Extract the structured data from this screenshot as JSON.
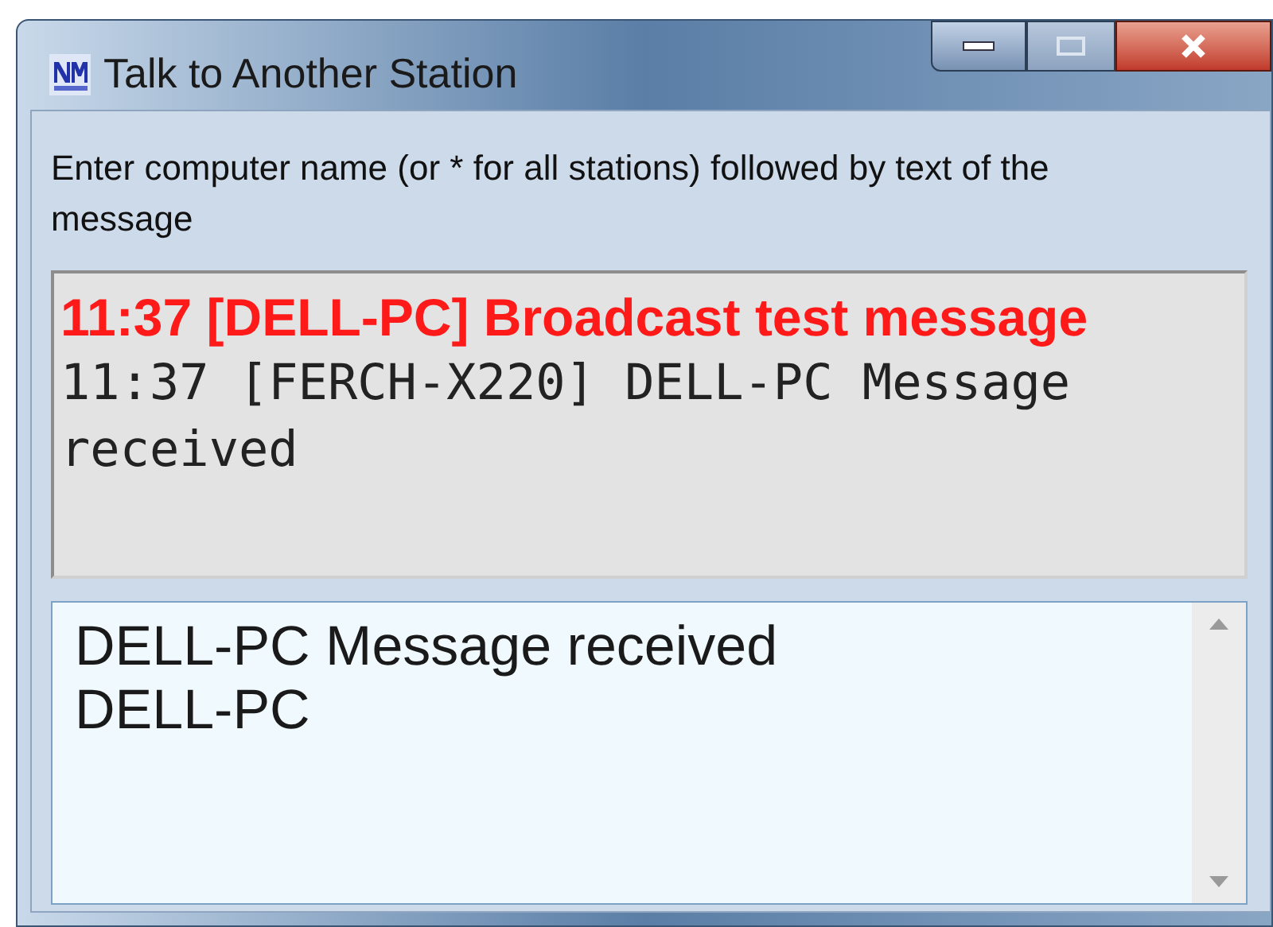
{
  "window": {
    "title": "Talk to Another Station"
  },
  "prompt": "Enter computer name (or * for all stations) followed by text of the message",
  "log": {
    "lines": [
      {
        "kind": "broadcast",
        "text": "11:37 [DELL-PC] Broadcast test message"
      },
      {
        "kind": "reply",
        "text": "11:37 [FERCH-X220] DELL-PC Message received"
      }
    ]
  },
  "input": {
    "value": "DELL-PC Message received\nDELL-PC"
  }
}
